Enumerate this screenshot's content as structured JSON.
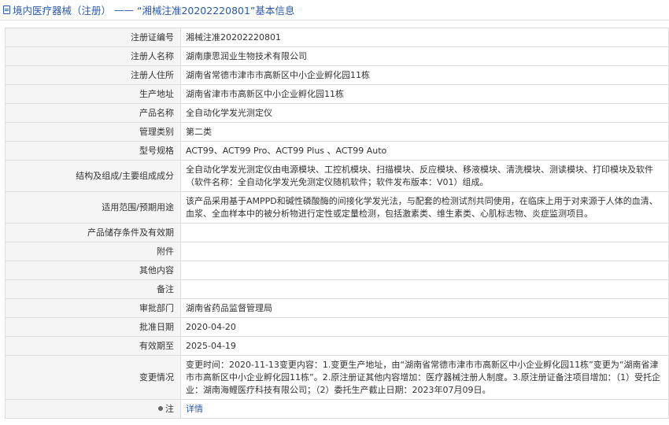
{
  "header": {
    "section": "境内医疗器械（注册）",
    "separator": " —— ",
    "title": "“湘械注准20202220801”基本信息"
  },
  "rows": [
    {
      "label": "注册证编号",
      "value": "湘械注准20202220801"
    },
    {
      "label": "注册人名称",
      "value": "湖南康思润业生物技术有限公司"
    },
    {
      "label": "注册人住所",
      "value": "湖南省常德市津市市高新区中小企业孵化园11栋"
    },
    {
      "label": "生产地址",
      "value": "湖南省津市市高新区中小企业孵化园11栋"
    },
    {
      "label": "产品名称",
      "value": "全自动化学发光测定仪"
    },
    {
      "label": "管理类别",
      "value": "第二类"
    },
    {
      "label": "型号规格",
      "value": "ACT99、ACT99 Pro、ACT99 Plus 、ACT99 Auto"
    },
    {
      "label": "结构及组成/主要组成成分",
      "value": "全自动化学发光测定仪由电源模块、工控机模块、扫描模块、反应模块、移液模块、清洗模块、测读模块、打印模块及软件（软件名称：全自动化学发光免测定仪随机软件；软件发布版本：V01）组成。"
    },
    {
      "label": "适用范围/预期用途",
      "value": "该产品采用基于AMPPD和碱性磷酸酶的间接化学发光法，与配套的检测试剂共同使用，在临床上用于对来源于人体的血清、血浆、全血样本中的被分析物进行定性或定量检测，包括激素类、维生素类、心肌标志物、炎症监测项目。"
    },
    {
      "label": "产品储存条件及有效期",
      "value": ""
    },
    {
      "label": "附件",
      "value": ""
    },
    {
      "label": "其他内容",
      "value": ""
    },
    {
      "label": "备注",
      "value": ""
    },
    {
      "label": "审批部门",
      "value": "湖南省药品监督管理局"
    },
    {
      "label": "批准日期",
      "value": "2020-04-20"
    },
    {
      "label": "有效期至",
      "value": "2025-04-19"
    },
    {
      "label": "变更情况",
      "value": "变更时间：2020-11-13变更内容：1.变更生产地址，由“湖南省常德市津市市高新区中小企业孵化园11栋”变更为“湖南省津市市高新区中小企业孵化园11栋”。2.原注册证其他内容增加：医疗器械注册人制度。3.原注册证备注项目增加：（1）受托企业：湖南海鲤医疗科技有限公司；（2）委托生产截止日期：2023年07月09日。"
    }
  ],
  "note": {
    "label": "注",
    "link": "详情",
    "icon": "location-pin-icon"
  }
}
